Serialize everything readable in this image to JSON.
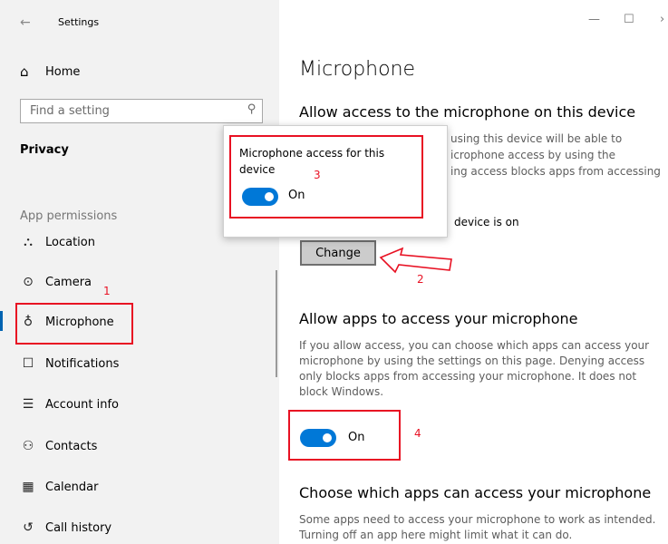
{
  "window": {
    "title": "Settings",
    "back_icon": "back-arrow-icon",
    "controls": {
      "minimize": "—",
      "maximize": "☐",
      "close": "›"
    }
  },
  "sidebar": {
    "home_label": "Home",
    "search_placeholder": "Find a setting",
    "section_heading": "Privacy",
    "permissions_heading": "App permissions",
    "items": [
      {
        "label": "Location",
        "icon": "location-icon",
        "glyph": "⛬"
      },
      {
        "label": "Camera",
        "icon": "camera-icon",
        "glyph": "⊙"
      },
      {
        "label": "Microphone",
        "icon": "microphone-icon",
        "glyph": "♁",
        "selected": true
      },
      {
        "label": "Notifications",
        "icon": "notifications-icon",
        "glyph": "☐"
      },
      {
        "label": "Account info",
        "icon": "account-info-icon",
        "glyph": "☰"
      },
      {
        "label": "Contacts",
        "icon": "contacts-icon",
        "glyph": "⚇"
      },
      {
        "label": "Calendar",
        "icon": "calendar-icon",
        "glyph": "▦"
      },
      {
        "label": "Call history",
        "icon": "call-history-icon",
        "glyph": "↺"
      }
    ]
  },
  "main": {
    "title": "Microphone",
    "section1": {
      "heading": "Allow access to the microphone on this device",
      "desc_visible_lines": [
        "using this device will be able to",
        "icrophone access by using the",
        "ing access blocks apps from accessing"
      ],
      "status": "device is on",
      "change_label": "Change"
    },
    "section2": {
      "heading": "Allow apps to access your microphone",
      "desc": "If you allow access, you can choose which apps can access your microphone by using the settings on this page. Denying access only blocks apps from accessing your microphone. It does not block Windows.",
      "toggle_label": "On",
      "toggle_on": true
    },
    "section3": {
      "heading": "Choose which apps can access your microphone",
      "desc": "Some apps need to access your microphone to work as intended. Turning off an app here might limit what it can do."
    }
  },
  "popup": {
    "title": "Microphone access for this device",
    "toggle_label": "On",
    "toggle_on": true
  },
  "annotations": {
    "n1": "1",
    "n2": "2",
    "n3": "3",
    "n4": "4",
    "color": "#e81123"
  },
  "colors": {
    "accent": "#0078d7",
    "sidebar_bg": "#f2f2f2"
  }
}
